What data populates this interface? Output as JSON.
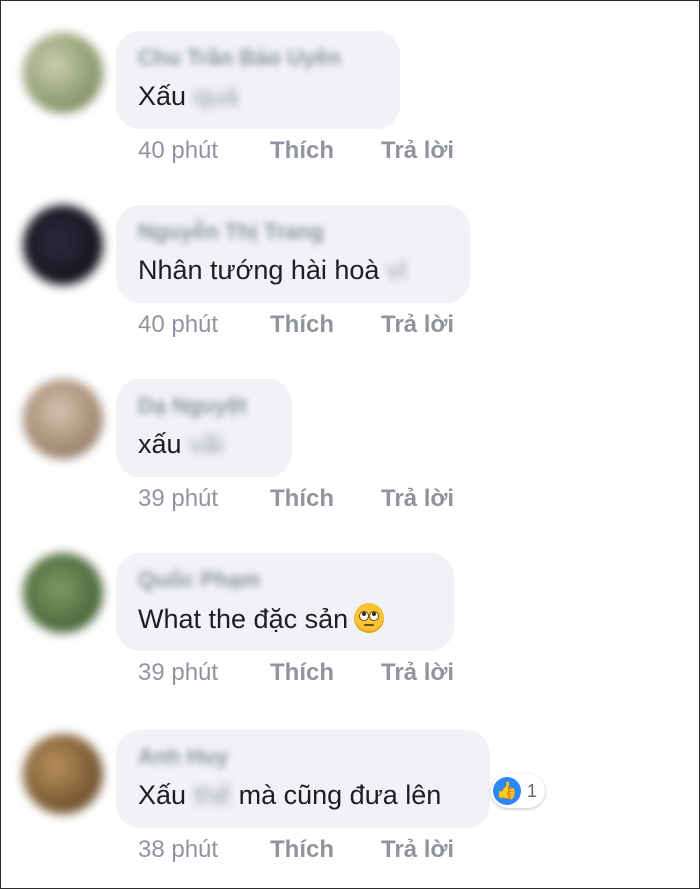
{
  "comments": [
    {
      "author": "Chu Trần Bảo Uyên",
      "text": "Xấu",
      "hidden_text": "quá",
      "time": "40 phút",
      "like_label": "Thích",
      "reply_label": "Trả lời",
      "avatar_color": "#a8b08e"
    },
    {
      "author": "Nguyễn Thị Trang",
      "text": "Nhân tướng hài hoà",
      "hidden_text": "vl",
      "time": "40 phút",
      "like_label": "Thích",
      "reply_label": "Trả lời",
      "avatar_color": "#1c1c2a"
    },
    {
      "author": "Dạ Nguyệt",
      "text": "xấu",
      "hidden_text": "vãi",
      "time": "39 phút",
      "like_label": "Thích",
      "reply_label": "Trả lời",
      "avatar_color": "#b09a86"
    },
    {
      "author": "Quốc Phạm",
      "text": "What the đặc sản",
      "emoji": "face-with-rolling-eyes-icon",
      "time": "39 phút",
      "like_label": "Thích",
      "reply_label": "Trả lời",
      "avatar_color": "#5e7a4c"
    },
    {
      "author": "Anh Huy",
      "text": "Xấu",
      "hidden_text": "thế",
      "text_after": "mà cũng đưa lên",
      "time": "38 phút",
      "like_label": "Thích",
      "reply_label": "Trả lời",
      "avatar_color": "#8a6a3e",
      "reaction": {
        "icon": "thumbs-up-icon",
        "count": "1",
        "color": "#2d88ff"
      }
    }
  ]
}
